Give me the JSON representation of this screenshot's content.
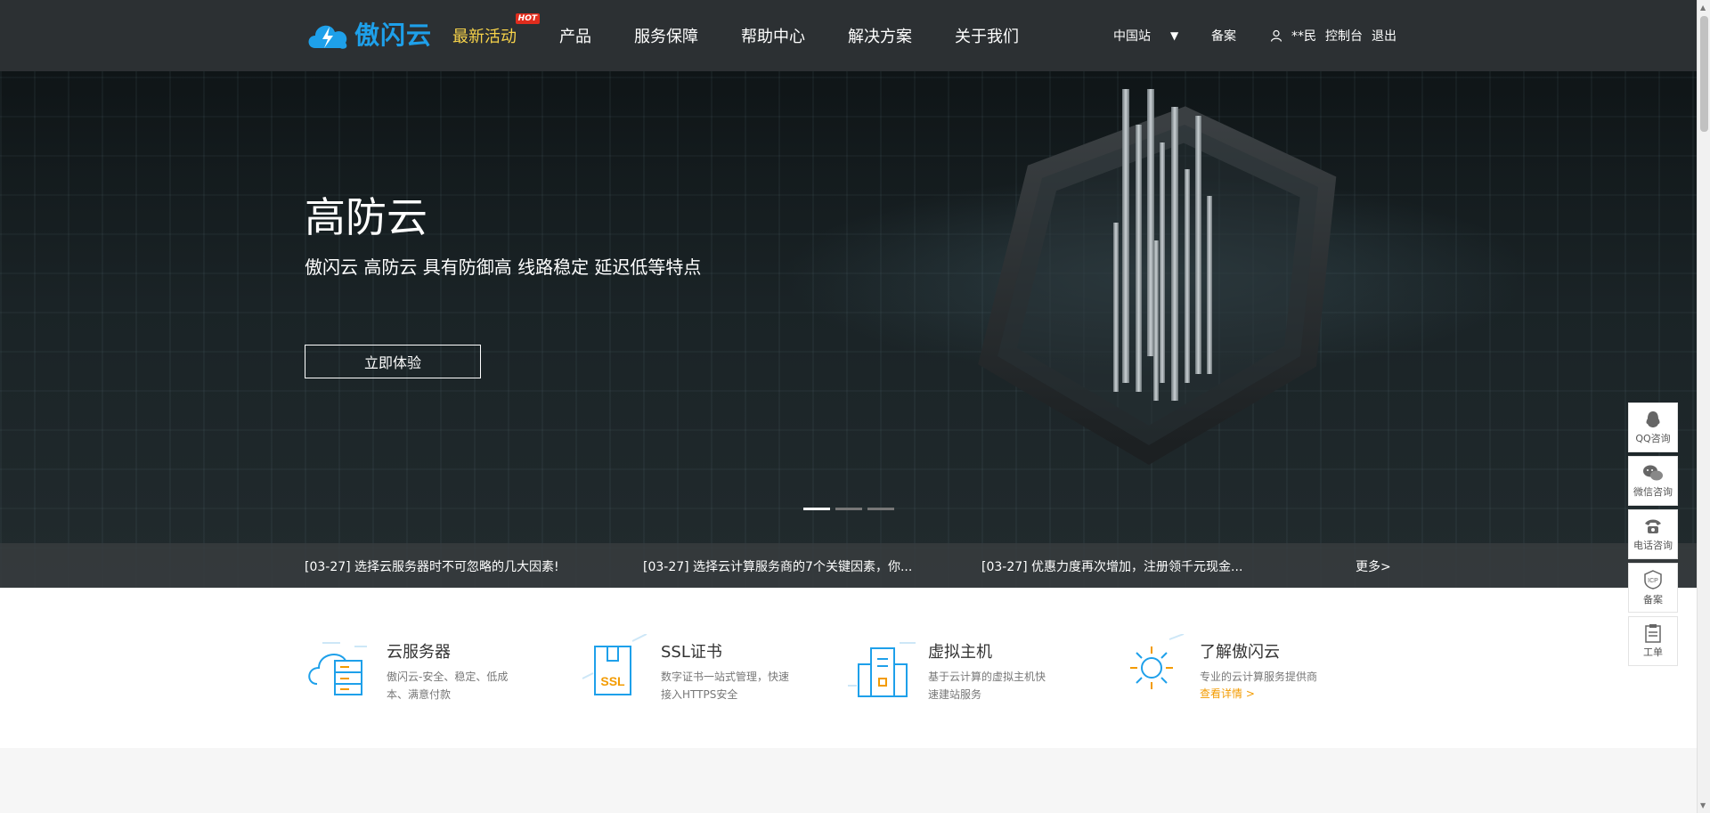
{
  "header": {
    "logo_text": "傲闪云",
    "nav": [
      {
        "label": "最新活动",
        "badge": "HOT"
      },
      {
        "label": "产品"
      },
      {
        "label": "服务保障"
      },
      {
        "label": "帮助中心"
      },
      {
        "label": "解决方案"
      },
      {
        "label": "关于我们"
      }
    ],
    "region": "中国站",
    "region_caret": "▼",
    "beian": "备案",
    "user": {
      "name": "**民",
      "console": "控制台",
      "logout": "退出"
    }
  },
  "banner": {
    "title": "高防云",
    "subtitle": "傲闪云 高防云 具有防御高 线路稳定 延迟低等特点",
    "button": "立即体验",
    "news": [
      "[03-27] 选择云服务器时不可忽略的几大因素!",
      "[03-27] 选择云计算服务商的7个关键因素，你...",
      "[03-27] 优惠力度再次增加，注册领千元现金..."
    ],
    "more": "更多>"
  },
  "features": [
    {
      "title": "云服务器",
      "desc": "傲闪云-安全、稳定、低成本、满意付款",
      "icon": "cloud-server-icon"
    },
    {
      "title": "SSL证书",
      "desc": "数字证书一站式管理，快速接入HTTPS安全",
      "icon": "ssl-icon",
      "icon_text": "SSL"
    },
    {
      "title": "虚拟主机",
      "desc": "基于云计算的虚拟主机快速建站服务",
      "icon": "virtual-host-icon"
    },
    {
      "title": "了解傲闪云",
      "desc": "专业的云计算服务提供商",
      "link": "查看详情 >",
      "icon": "sun-icon"
    }
  ],
  "float_bar": [
    {
      "label": "QQ咨询",
      "icon": "qq-icon"
    },
    {
      "label": "微信咨询",
      "icon": "wechat-icon"
    },
    {
      "label": "电话咨询",
      "icon": "phone-icon"
    },
    {
      "label": "备案",
      "icon": "icp-icon",
      "icon_text": "ICP"
    },
    {
      "label": "工单",
      "icon": "ticket-icon"
    }
  ],
  "colors": {
    "header_bg": "#2c3033",
    "accent": "#1ea0ea",
    "active_nav": "#f7d34a",
    "link_orange": "#f39b00",
    "hot": "#e02c1d"
  }
}
